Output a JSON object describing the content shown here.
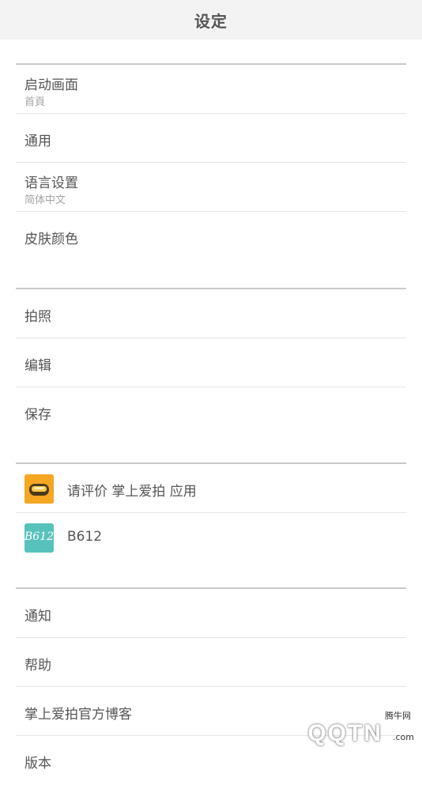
{
  "header": {
    "title": "设定"
  },
  "section1": {
    "items": [
      {
        "label": "启动画面",
        "sub": "首頁"
      },
      {
        "label": "通用"
      },
      {
        "label": "语言设置",
        "sub": "简体中文"
      },
      {
        "label": "皮肤颜色"
      }
    ]
  },
  "section2": {
    "items": [
      {
        "label": "拍照"
      },
      {
        "label": "编辑"
      },
      {
        "label": "保存"
      }
    ]
  },
  "section3": {
    "items": [
      {
        "label": "请评价 掌上爱拍 应用",
        "icon": "camera-app-icon",
        "color": "#f5a623"
      },
      {
        "label": "B612",
        "icon": "b612-app-icon",
        "color": "#57c2bc",
        "icon_text": "B612"
      }
    ]
  },
  "section4": {
    "items": [
      {
        "label": "通知"
      },
      {
        "label": "帮助"
      },
      {
        "label": "掌上爱拍官方博客"
      },
      {
        "label": "版本"
      }
    ]
  },
  "watermark": {
    "top": "腾牛网",
    "main": "QQTN",
    "suffix": ".com"
  }
}
